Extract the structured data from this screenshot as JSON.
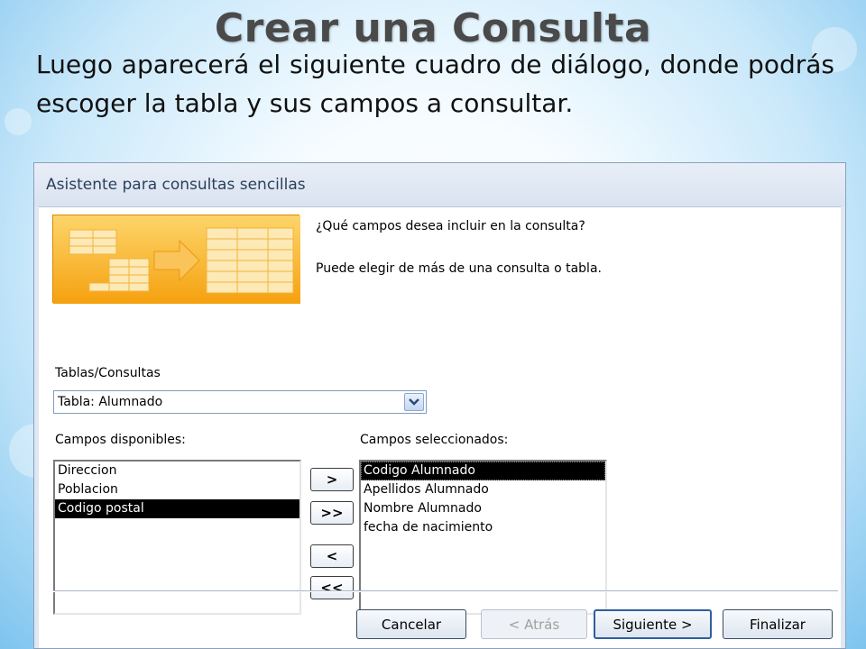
{
  "slide": {
    "title": "Crear una Consulta",
    "body": "Luego aparecerá el siguiente cuadro de diálogo, donde podrás escoger la tabla y sus campos a consultar."
  },
  "dialog": {
    "title": "Asistente para consultas sencillas",
    "question": "¿Qué campos desea incluir en la consulta?",
    "hint": "Puede elegir de más de una consulta o tabla.",
    "tables_label": "Tablas/Consultas",
    "tables_selected": "Tabla: Alumnado",
    "available_label": "Campos disponibles:",
    "available_fields": [
      "Direccion",
      "Poblacion",
      "Codigo postal"
    ],
    "selected_label": "Campos seleccionados:",
    "selected_fields": [
      "Codigo Alumnado",
      "Apellidos Alumnado",
      "Nombre Alumnado",
      "fecha de nacimiento"
    ],
    "move_buttons": {
      "add_one": ">",
      "add_all": ">>",
      "remove_one": "<",
      "remove_all": "<<"
    },
    "footer": {
      "cancel": "Cancelar",
      "back": "< Atrás",
      "next": "Siguiente >",
      "finish": "Finalizar"
    }
  },
  "colors": {
    "wizard_orange": "#fbb828",
    "selection": "#000000",
    "dialog_bg": "#dfe7f2"
  },
  "icons": [
    "wizard-tables-illustration",
    "dropdown-arrow-icon"
  ]
}
